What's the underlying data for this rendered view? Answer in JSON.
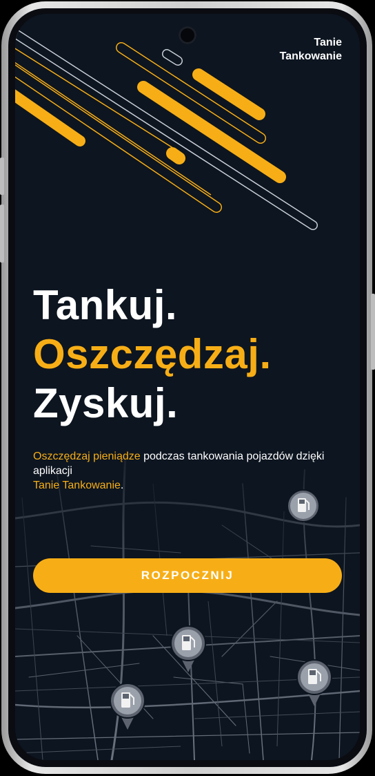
{
  "app": {
    "brand_line1": "Tanie",
    "brand_line2": "Tankowanie"
  },
  "hero": {
    "line1": "Tankuj.",
    "line2": "Oszczędzaj.",
    "line3": "Zyskuj."
  },
  "description": {
    "part1_accent": "Oszczędzaj pieniądze",
    "part2": " podczas tankowania pojazdów dzięki aplikacji",
    "part3_accent": "Tanie Tankowanie",
    "part4": "."
  },
  "cta": {
    "label": "ROZPOCZNIJ"
  },
  "colors": {
    "accent": "#f7ae16",
    "background": "#0d1520",
    "text": "#ffffff"
  },
  "icons": [
    "fuel-pump-icon",
    "map-pin-icon"
  ]
}
